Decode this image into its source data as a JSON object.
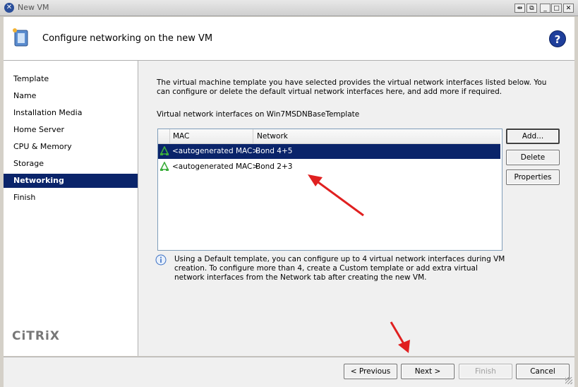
{
  "window": {
    "title": "New VM"
  },
  "header": {
    "title": "Configure networking on the new VM",
    "help_glyph": "?"
  },
  "sidebar": {
    "steps": [
      {
        "label": "Template"
      },
      {
        "label": "Name"
      },
      {
        "label": "Installation Media"
      },
      {
        "label": "Home Server"
      },
      {
        "label": "CPU & Memory"
      },
      {
        "label": "Storage"
      },
      {
        "label": "Networking",
        "active": true
      },
      {
        "label": "Finish"
      }
    ],
    "logo": "CiTRiX"
  },
  "main": {
    "description": "The virtual machine template you have selected provides the virtual network interfaces listed below. You can configure or delete the default virtual network interfaces here, and add more if required.",
    "list_label": "Virtual network interfaces on Win7MSDNBaseTemplate",
    "columns": {
      "mac": "MAC",
      "network": "Network"
    },
    "rows": [
      {
        "mac": "<autogenerated MAC>",
        "network": "Bond 4+5",
        "selected": true
      },
      {
        "mac": "<autogenerated MAC>",
        "network": "Bond 2+3",
        "selected": false
      }
    ],
    "buttons": {
      "add": "Add...",
      "delete": "Delete",
      "properties": "Properties"
    },
    "info": "Using a Default template, you can configure up to 4 virtual network interfaces during VM creation. To configure more than 4, create a Custom template or add extra virtual network interfaces from the Network tab after creating the new VM."
  },
  "footer": {
    "previous": "< Previous",
    "next": "Next >",
    "finish": "Finish",
    "cancel": "Cancel"
  },
  "colors": {
    "selection": "#0a246a",
    "annotation_arrow": "#e02020"
  }
}
